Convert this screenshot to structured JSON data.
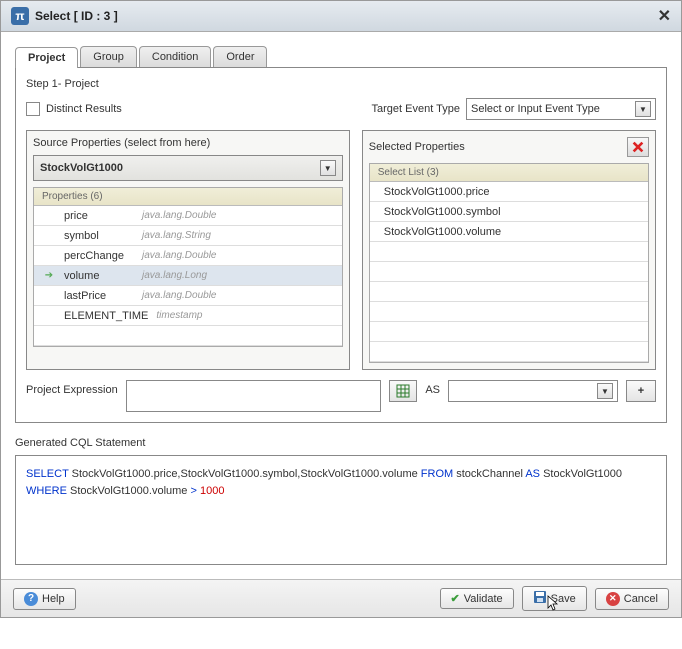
{
  "title": "Select [ ID : 3 ]",
  "tabs": [
    "Project",
    "Group",
    "Condition",
    "Order"
  ],
  "active_tab": 0,
  "step_title": "Step 1- Project",
  "distinct_label": "Distinct Results",
  "distinct_checked": false,
  "target_event_label": "Target Event Type",
  "target_event_value": "Select or Input Event Type",
  "source": {
    "title": "Source Properties (select from here)",
    "stream": "StockVolGt1000",
    "props_header": "Properties (6)",
    "props": [
      {
        "name": "price",
        "type": "java.lang.Double",
        "selected": false
      },
      {
        "name": "symbol",
        "type": "java.lang.String",
        "selected": false
      },
      {
        "name": "percChange",
        "type": "java.lang.Double",
        "selected": false
      },
      {
        "name": "volume",
        "type": "java.lang.Long",
        "selected": true
      },
      {
        "name": "lastPrice",
        "type": "java.lang.Double",
        "selected": false
      },
      {
        "name": "ELEMENT_TIME",
        "type": "timestamp",
        "selected": false
      }
    ]
  },
  "selected": {
    "title": "Selected Properties",
    "list_header": "Select List (3)",
    "items": [
      "StockVolGt1000.price",
      "StockVolGt1000.symbol",
      "StockVolGt1000.volume"
    ]
  },
  "expr": {
    "label": "Project Expression",
    "as_label": "AS",
    "as_value": ""
  },
  "cql": {
    "title": "Generated CQL Statement",
    "tokens": [
      {
        "t": "SELECT",
        "k": "kw"
      },
      {
        "t": " StockVolGt1000.price,StockVolGt1000.symbol,StockVolGt1000.volume "
      },
      {
        "t": "FROM",
        "k": "kw"
      },
      {
        "t": " stockChannel "
      },
      {
        "t": "AS",
        "k": "kw"
      },
      {
        "t": " StockVolGt1000 "
      },
      {
        "t": "WHERE",
        "k": "kw"
      },
      {
        "t": " StockVolGt1000.volume "
      },
      {
        "t": ">",
        "k": "kw"
      },
      {
        "t": " "
      },
      {
        "t": "1000",
        "k": "num"
      }
    ]
  },
  "footer": {
    "help": "Help",
    "validate": "Validate",
    "save": "Save",
    "cancel": "Cancel"
  }
}
